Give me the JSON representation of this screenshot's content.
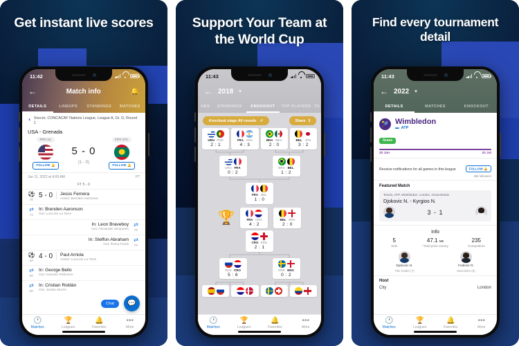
{
  "colors": {
    "brand_blue": "#0a6ed1",
    "accent_gold": "#d8ab3e",
    "wimbledon_purple": "#4c2a82",
    "bg_navy": "#05142e",
    "block_blue": "#2b49b8"
  },
  "panels": [
    {
      "headline": "Get instant live scores",
      "status": {
        "time": "11:42"
      },
      "nav": {
        "back_icon": "arrow-left-icon",
        "title": "Match info",
        "bell_icon": "bell-icon"
      },
      "tabs": [
        {
          "label": "DETAILS",
          "active": true
        },
        {
          "label": "LINEUPS",
          "active": false
        },
        {
          "label": "STANDINGS",
          "active": false
        },
        {
          "label": "MATCHES",
          "active": false
        }
      ],
      "league": {
        "icon": "league-icon",
        "text": "Soccer, CONCACAF Nations League, League A, Gr. D, Round 1"
      },
      "match_title": "USA - Grenada",
      "home": {
        "rank": "FIFA 14.",
        "flag": "usa-flag",
        "follow": "FOLLOW"
      },
      "away": {
        "rank": "FIFA 171.",
        "flag": "grenada-flag",
        "follow": "FOLLOW"
      },
      "score": "5 - 0",
      "halftime": "(1 - 0)",
      "date": "Jun 11, 2022 at 4:00 AM",
      "status_short": "FT",
      "ft_line": "FT 5 - 0",
      "events": [
        {
          "side": "left",
          "icon": "goal-icon",
          "minute": "78'",
          "score": "5 - 0",
          "primary": "Jesús Ferreira",
          "secondary": "Assist: Brenden Aaronson"
        },
        {
          "side": "left",
          "icon": "substitution-icon",
          "minute": "71'",
          "score": "",
          "primary": "In: Brenden Aaronson",
          "secondary": "Out: Luca De La Torre"
        },
        {
          "side": "right",
          "icon": "substitution-icon",
          "minute": "70'",
          "score": "",
          "primary": "In: Leon Braveboy",
          "secondary": "Out: Alexander McQueen"
        },
        {
          "side": "right",
          "icon": "substitution-icon",
          "minute": "70'",
          "score": "",
          "primary": "In: Steffon Abraham",
          "secondary": "Out: Roma Frank"
        },
        {
          "side": "left",
          "icon": "goal-icon",
          "minute": "62'",
          "score": "4 - 0",
          "primary": "Paul Arriola",
          "secondary": "Assist: Luca De La Torre"
        },
        {
          "side": "left",
          "icon": "substitution-icon",
          "minute": "60'",
          "score": "",
          "primary": "In: George Bello",
          "secondary": "Out: Antonee Robinson"
        },
        {
          "side": "left",
          "icon": "substitution-icon",
          "minute": "60'",
          "score": "",
          "primary": "In: Cristian Roldán",
          "secondary": "Out: Jordan Morris"
        }
      ],
      "chat_label": "Chat",
      "fab_icon": "chat-bubble-icon",
      "tabbar": [
        {
          "icon": "clock-icon",
          "label": "Matches",
          "active": true
        },
        {
          "icon": "trophy-icon",
          "label": "Leagues",
          "active": false
        },
        {
          "icon": "bell-icon",
          "label": "Favorites",
          "active": false
        },
        {
          "icon": "more-dots-icon",
          "label": "More",
          "active": false
        }
      ]
    },
    {
      "headline": "Support Your Team at the World Cup",
      "status": {
        "time": "11:43"
      },
      "nav": {
        "back_icon": "arrow-left-icon",
        "title": "2018",
        "caret_icon": "chevron-down-icon"
      },
      "tabs": [
        {
          "label": "HES",
          "active": false
        },
        {
          "label": "STANDINGS",
          "active": false
        },
        {
          "label": "KNOCKOUT",
          "active": true
        },
        {
          "label": "TOP PLAYERS",
          "active": false
        },
        {
          "label": "TO",
          "active": false
        }
      ],
      "round_pill": {
        "label": "Knockout stage All rounds",
        "icon": "external-link-icon"
      },
      "share_pill": {
        "label": "Share",
        "icon": "share-icon"
      },
      "bracket": {
        "round_of_16": [
          {
            "home": {
              "abbr": "URU",
              "flag": "uru-flag",
              "winner": true
            },
            "away": {
              "abbr": "POR",
              "flag": "por-flag",
              "winner": false
            },
            "score": "2 : 1"
          },
          {
            "home": {
              "abbr": "FRA",
              "flag": "fra-flag",
              "winner": true
            },
            "away": {
              "abbr": "ARG",
              "flag": "arg-flag",
              "winner": false
            },
            "score": "4 : 3"
          },
          {
            "home": {
              "abbr": "BRA",
              "flag": "bra-flag",
              "winner": true
            },
            "away": {
              "abbr": "MEX",
              "flag": "mex-flag",
              "winner": false
            },
            "score": "2 : 0"
          },
          {
            "home": {
              "abbr": "BEL",
              "flag": "bel-flag",
              "winner": true
            },
            "away": {
              "abbr": "JPN",
              "flag": "jpn-flag",
              "winner": false
            },
            "score": "3 : 2"
          }
        ],
        "quarter_finals": [
          {
            "home": {
              "abbr": "URU",
              "flag": "uru-flag",
              "winner": false
            },
            "away": {
              "abbr": "FRA",
              "flag": "fra-flag",
              "winner": true
            },
            "score": "0 : 2"
          },
          {
            "home": {
              "abbr": "BRA",
              "flag": "bra-flag",
              "winner": false
            },
            "away": {
              "abbr": "BEL",
              "flag": "bel-flag",
              "winner": true
            },
            "score": "1 : 2"
          }
        ],
        "semi_final": {
          "home": {
            "abbr": "FRA",
            "flag": "fra-flag",
            "winner": true
          },
          "away": {
            "abbr": "BEL",
            "flag": "bel-flag",
            "winner": false
          },
          "score": "1 : 0"
        },
        "final": {
          "home": {
            "abbr": "FRA",
            "flag": "fra-flag",
            "winner": true
          },
          "away": {
            "abbr": "CRO",
            "flag": "cro-flag",
            "winner": false
          },
          "score": "4 : 2"
        },
        "third_place": {
          "home": {
            "abbr": "BEL",
            "flag": "bel-flag",
            "winner": true
          },
          "away": {
            "abbr": "ENG",
            "flag": "eng-flag",
            "winner": false
          },
          "score": "2 : 0"
        },
        "semi_final_2": {
          "home": {
            "abbr": "CRO",
            "flag": "cro-flag",
            "winner": true
          },
          "away": {
            "abbr": "ENG",
            "flag": "eng-flag",
            "winner": false
          },
          "score": "2 : 1"
        },
        "quarter_finals_2": [
          {
            "home": {
              "abbr": "RUS",
              "flag": "rus-flag",
              "winner": false
            },
            "away": {
              "abbr": "CRO",
              "flag": "cro-flag",
              "winner": true
            },
            "score": "5 : 6"
          },
          {
            "home": {
              "abbr": "SWE",
              "flag": "swe-flag",
              "winner": false
            },
            "away": {
              "abbr": "ENG",
              "flag": "eng-flag",
              "winner": true
            },
            "score": "0 : 2"
          }
        ],
        "trophy_icon": "trophy-icon"
      },
      "tabbar": [
        {
          "icon": "clock-icon",
          "label": "Matches",
          "active": true
        },
        {
          "icon": "trophy-icon",
          "label": "Leagues",
          "active": false
        },
        {
          "icon": "bell-icon",
          "label": "Favorites",
          "active": false
        },
        {
          "icon": "more-dots-icon",
          "label": "More",
          "active": false
        }
      ]
    },
    {
      "headline": "Find every tournament detail",
      "status": {
        "time": "11:43"
      },
      "nav": {
        "back_icon": "arrow-left-icon",
        "title": "2022",
        "caret_icon": "chevron-down-icon"
      },
      "tabs": [
        {
          "label": "DETAILS",
          "active": true
        },
        {
          "label": "MATCHES",
          "active": false
        },
        {
          "label": "KNOCKOUT",
          "active": false
        }
      ],
      "tournament": {
        "name": "Wimbledon",
        "tour": "ATP",
        "surface": "Grass",
        "logo_icon": "wimbledon-logo-icon"
      },
      "dates": {
        "start": "20 Jun",
        "end": "10 Jul"
      },
      "notify": {
        "text": "Receive notifications for all games in this league",
        "button": "FOLLOW",
        "followers": "46k followers"
      },
      "featured": {
        "section_title": "Featured Match",
        "meta": "Tennis, ATP, Wimbledon, London, Great Britain",
        "names": "Djokovic N. - Kyrgios N.",
        "score": "3 - 1",
        "home_avatar": "djokovic-avatar",
        "away_avatar": "kyrgios-avatar"
      },
      "info": {
        "title": "Info",
        "stats": [
          {
            "value": "5",
            "unit": "",
            "label": "Sets"
          },
          {
            "value": "47.1",
            "unit": "M€",
            "label": "*Total prize money"
          },
          {
            "value": "235",
            "unit": "",
            "label": "Competitors"
          }
        ],
        "players": [
          {
            "avatar": "djokovic-avatar",
            "name": "Djokovic N.",
            "role": "Title holder (7)"
          },
          {
            "avatar": "federer-avatar",
            "name": "Federer R.",
            "role": "Most titles (8)"
          }
        ]
      },
      "host": {
        "title": "Host",
        "rows": [
          {
            "label": "City",
            "value": "London"
          }
        ]
      },
      "tabbar": [
        {
          "icon": "clock-icon",
          "label": "Matches",
          "active": true
        },
        {
          "icon": "trophy-icon",
          "label": "Leagues",
          "active": false
        },
        {
          "icon": "bell-icon",
          "label": "Favorites",
          "active": false
        },
        {
          "icon": "more-dots-icon",
          "label": "More",
          "active": false
        }
      ]
    }
  ]
}
